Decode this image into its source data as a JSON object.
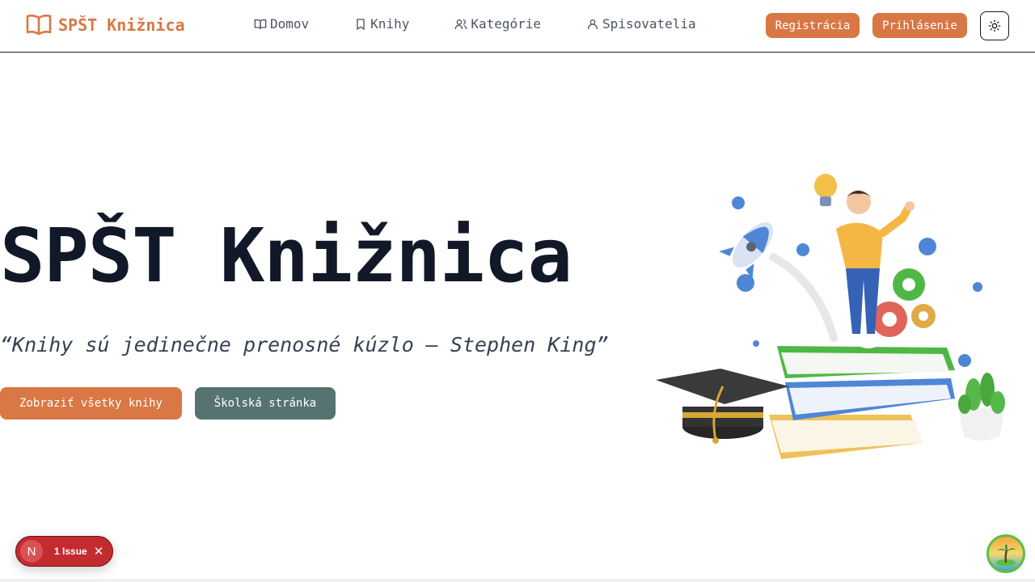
{
  "navbar": {
    "brand": "SPŠT Knižnica",
    "links": [
      {
        "label": "Domov",
        "icon": "book-open-icon"
      },
      {
        "label": "Knihy",
        "icon": "bookmark-icon"
      },
      {
        "label": "Kategórie",
        "icon": "users-icon"
      },
      {
        "label": "Spisovatelia",
        "icon": "user-icon"
      }
    ],
    "register_label": "Registrácia",
    "login_label": "Prihlásenie",
    "theme_icon": "sun-icon"
  },
  "hero": {
    "title": "SPŠT Knižnica",
    "quote": "“Knihy sú jedinečne prenosné kúzlo — Stephen King”",
    "primary_button": "Zobraziť všetky knihy",
    "secondary_button": "Školská stránka"
  },
  "issue_badge": {
    "logo": "N",
    "text": "1 Issue",
    "close": "✕"
  },
  "colors": {
    "accent": "#d97745",
    "secondary": "#557471",
    "text": "#111827",
    "issue": "#c42b2f"
  }
}
